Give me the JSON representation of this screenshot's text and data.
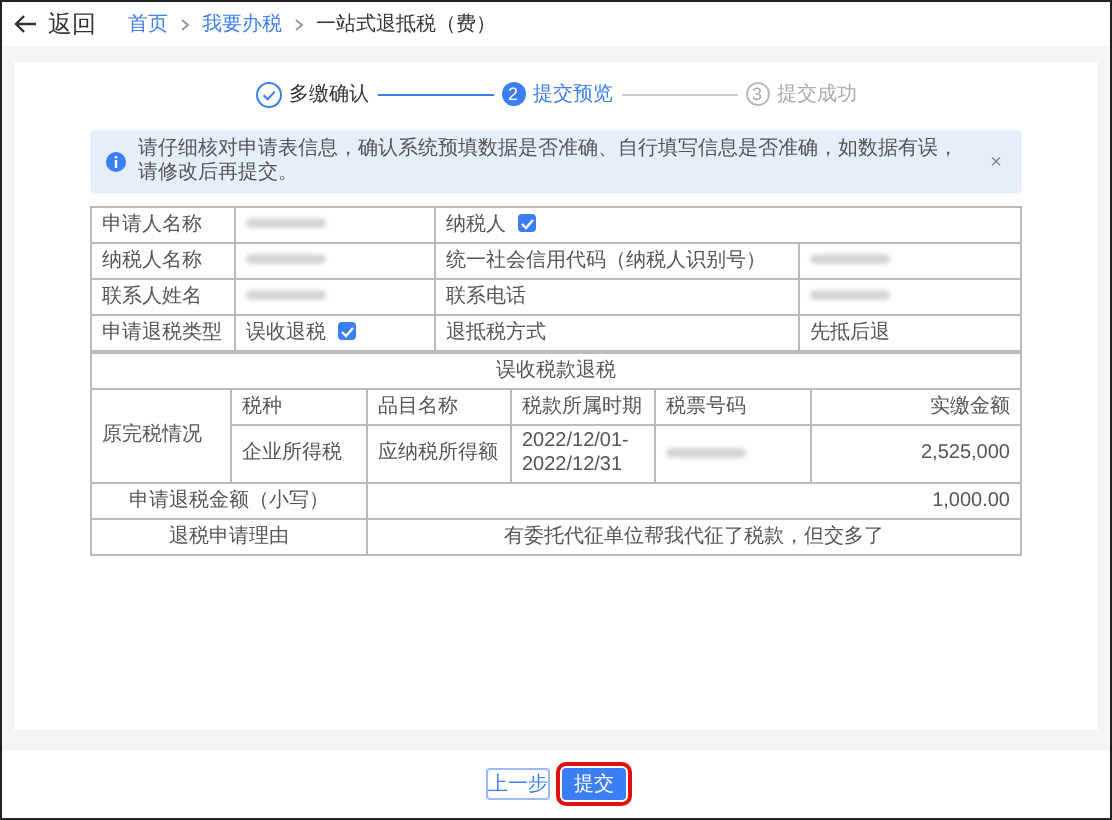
{
  "header": {
    "back": "返回",
    "breadcrumb": [
      {
        "text": "首页",
        "link": true
      },
      {
        "text": "我要办税",
        "link": true
      },
      {
        "text": "一站式退抵税（费）",
        "link": false
      }
    ]
  },
  "steps": [
    {
      "label": "多缴确认",
      "completed": true,
      "selected": false
    },
    {
      "number": "2",
      "label": "提交预览",
      "completed": false,
      "selected": true
    },
    {
      "number": "3",
      "label": "提交成功",
      "completed": false,
      "selected": false
    }
  ],
  "alert": {
    "text": "请仔细核对申请表信息，确认系统预填数据是否准确、自行填写信息是否准确，如数据有误，请修改后再提交。",
    "close": "×"
  },
  "form": {
    "fields": [
      [
        {
          "kind": "label",
          "text": "申请人名称"
        },
        {
          "kind": "blurred"
        },
        {
          "kind": "check",
          "text": "纳税人",
          "checked": true,
          "wide": true
        }
      ],
      [
        {
          "kind": "label",
          "text": "纳税人名称"
        },
        {
          "kind": "blurred"
        },
        {
          "kind": "label",
          "text": "统一社会信用代码（纳税人识别号）"
        },
        {
          "kind": "blurred"
        }
      ],
      [
        {
          "kind": "label",
          "text": "联系人姓名"
        },
        {
          "kind": "blurred"
        },
        {
          "kind": "label",
          "text": "联系电话"
        },
        {
          "kind": "blurred"
        }
      ],
      [
        {
          "kind": "label",
          "text": "申请退税类型"
        },
        {
          "kind": "check",
          "text": "误收退税",
          "checked": true
        },
        {
          "kind": "label",
          "text": "退抵税方式"
        },
        {
          "kind": "value",
          "text": "先抵后退"
        }
      ]
    ],
    "section_title": "误收税款退税",
    "original_tax": {
      "label": "原完税情况",
      "columns": [
        "税种",
        "品目名称",
        "税款所属时期",
        "税票号码",
        "实缴金额"
      ],
      "rows": [
        [
          {
            "text": "企业所得税"
          },
          {
            "text": "应纳税所得额"
          },
          {
            "text": "2022/12/01-2022/12/31"
          },
          {
            "blurred": true
          },
          {
            "text": "2,525,000"
          }
        ]
      ]
    },
    "refund_amount": {
      "label": "申请退税金额（小写）",
      "value": "1,000.00"
    },
    "refund_reason": {
      "label": "退税申请理由",
      "value": "有委托代征单位帮我代征了税款，但交多了"
    }
  },
  "buttons": [
    {
      "label": "上一步",
      "kind": "secondary",
      "highlighted": false
    },
    {
      "label": "提交",
      "kind": "primary",
      "highlighted": true
    }
  ]
}
